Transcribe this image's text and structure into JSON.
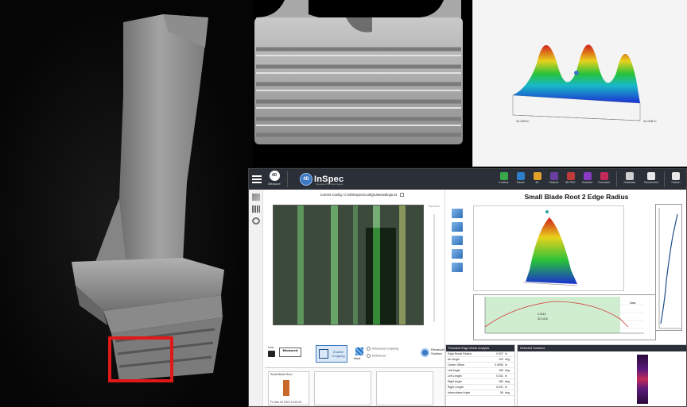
{
  "app": {
    "logo_mark": "4D",
    "logo_name": "InSpec",
    "tagline": "Integrated Surface Gauge",
    "measure_mark": "4D",
    "measure_label": "Measure"
  },
  "toolbar": {
    "tools": [
      {
        "id": "contour",
        "label": "Contour",
        "color": "#3aa64a"
      },
      {
        "id": "traces",
        "label": "Traces",
        "color": "#2b7ec7"
      },
      {
        "id": "3d",
        "label": "3D",
        "color": "#e0a02a"
      },
      {
        "id": "feature",
        "label": "Feature",
        "color": "#6a3fa0"
      },
      {
        "id": "3d-rdc",
        "label": "3D RDC",
        "color": "#c23a3a"
      },
      {
        "id": "chamfer",
        "label": "Chamfer",
        "color": "#8a3ac2"
      },
      {
        "id": "rounded",
        "label": "Rounded",
        "color": "#c22a5a"
      }
    ],
    "database_label": "Database",
    "screenshot_label": "Screenshot",
    "python_label": "Python"
  },
  "config": {
    "label": "Current Config:",
    "path": "C:\\4D\\Inspec\\Config\\Usersettings.ini"
  },
  "slider_label": "Exposure",
  "controls": {
    "live_label": "Live",
    "measured_label": "Measured",
    "enable_cropping": "Enable Cropping",
    "mask_label": "Mask",
    "advanced_cropping": "Advanced Cropping",
    "reference": "Reference",
    "recalculate": "Recalculate Surface"
  },
  "thumbnails": [
    {
      "title": "Small Blade Root...",
      "caption": "Fri Mar 04 2022 11:00:33"
    },
    {
      "title": "",
      "caption": ""
    },
    {
      "title": "",
      "caption": ""
    }
  ],
  "analysis": {
    "title": "Small Blade Root 2 Edge Radius",
    "table_title": "Rounded Edge Break Analysis",
    "surfaces_title": "Detected Surfaces",
    "rows": [
      {
        "k": "Edge Break Radius",
        "v": "0.007",
        "u": "in"
      },
      {
        "k": "Arc Angle",
        "v": "120",
        "u": "deg"
      },
      {
        "k": "Center Offset",
        "v": "0.0050",
        "u": "in"
      },
      {
        "k": "Left Angle",
        "v": "180",
        "u": "deg"
      },
      {
        "k": "Left Length",
        "v": "0.031",
        "u": "in"
      },
      {
        "k": "Right Angle",
        "v": "180",
        "u": "deg"
      },
      {
        "k": "Right Length",
        "v": "0.031",
        "u": "in"
      },
      {
        "k": "Intersurface Angle",
        "v": "56",
        "u": "deg"
      }
    ],
    "profile_legend": "Data",
    "profile_note": "0.0113",
    "profile_note2": "92.1418"
  },
  "surface_panel": {
    "coord_left": "41.000 in",
    "coord_right": "41.028 in"
  }
}
